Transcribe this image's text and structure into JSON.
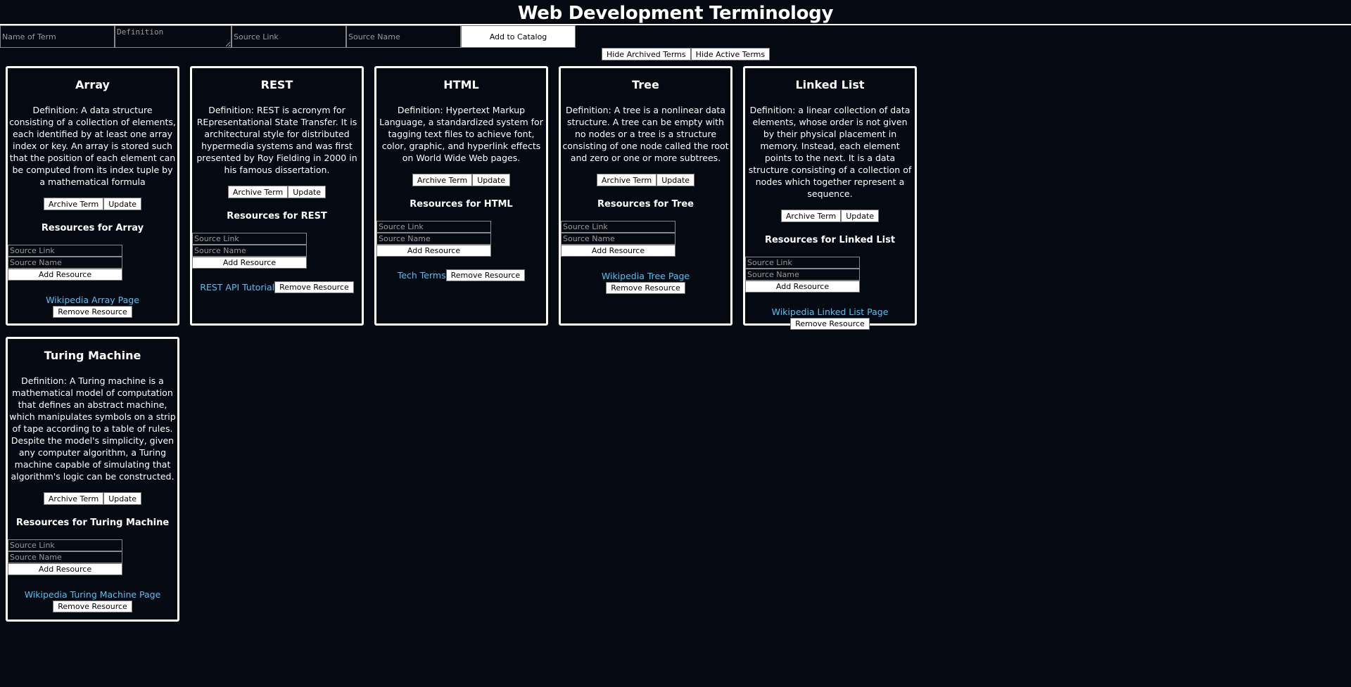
{
  "page": {
    "title": "Web Development Terminology"
  },
  "add_form": {
    "term_placeholder": "Name of Term",
    "definition_placeholder": "Definition",
    "link_placeholder": "Source Link",
    "name_placeholder": "Source Name",
    "submit_label": "Add to Catalog"
  },
  "toggles": {
    "archived_label": "Hide Archived Terms",
    "active_label": "Hide Active Terms"
  },
  "labels": {
    "archive": "Archive Term",
    "update": "Update",
    "link_placeholder": "Source Link",
    "name_placeholder": "Source Name",
    "add_resource": "Add Resource",
    "remove_resource": "Remove Resource"
  },
  "terms": [
    {
      "name": "Array",
      "definition": "Definition: A data structure consisting of a collection of elements, each identified by at least one array index or key. An array is stored such that the position of each element can be computed from its index tuple by a mathematical formula",
      "resources_heading": "Resources for Array",
      "resource": "Wikipedia Array Page"
    },
    {
      "name": "REST",
      "definition": "Definition: REST is acronym for REpresentational State Transfer. It is architectural style for distributed hypermedia systems and was first presented by Roy Fielding in 2000 in his famous dissertation.",
      "resources_heading": "Resources for REST",
      "resource": "REST API Tutorial"
    },
    {
      "name": "HTML",
      "definition": "Definition: Hypertext Markup Language, a standardized system for tagging text files to achieve font, color, graphic, and hyperlink effects on World Wide Web pages.",
      "resources_heading": "Resources for HTML",
      "resource": "Tech Terms"
    },
    {
      "name": "Tree",
      "definition": "Definition: A tree is a nonlinear data structure. A tree can be empty with no nodes or a tree is a structure consisting of one node called the root and zero or one or more subtrees.",
      "resources_heading": "Resources for Tree",
      "resource": "Wikipedia Tree Page"
    },
    {
      "name": "Linked List",
      "definition": "Definition: a linear collection of data elements, whose order is not given by their physical placement in memory. Instead, each element points to the next. It is a data structure consisting of a collection of nodes which together represent a sequence.",
      "resources_heading": "Resources for Linked List",
      "resource": "Wikipedia Linked List Page"
    },
    {
      "name": "Turing Machine",
      "definition": "Definition: A Turing machine is a mathematical model of computation that defines an abstract machine, which manipulates symbols on a strip of tape according to a table of rules. Despite the model's simplicity, given any computer algorithm, a Turing machine capable of simulating that algorithm's logic can be constructed.",
      "resources_heading": "Resources for Turing Machine",
      "resource": "Wikipedia Turing Machine Page"
    }
  ]
}
